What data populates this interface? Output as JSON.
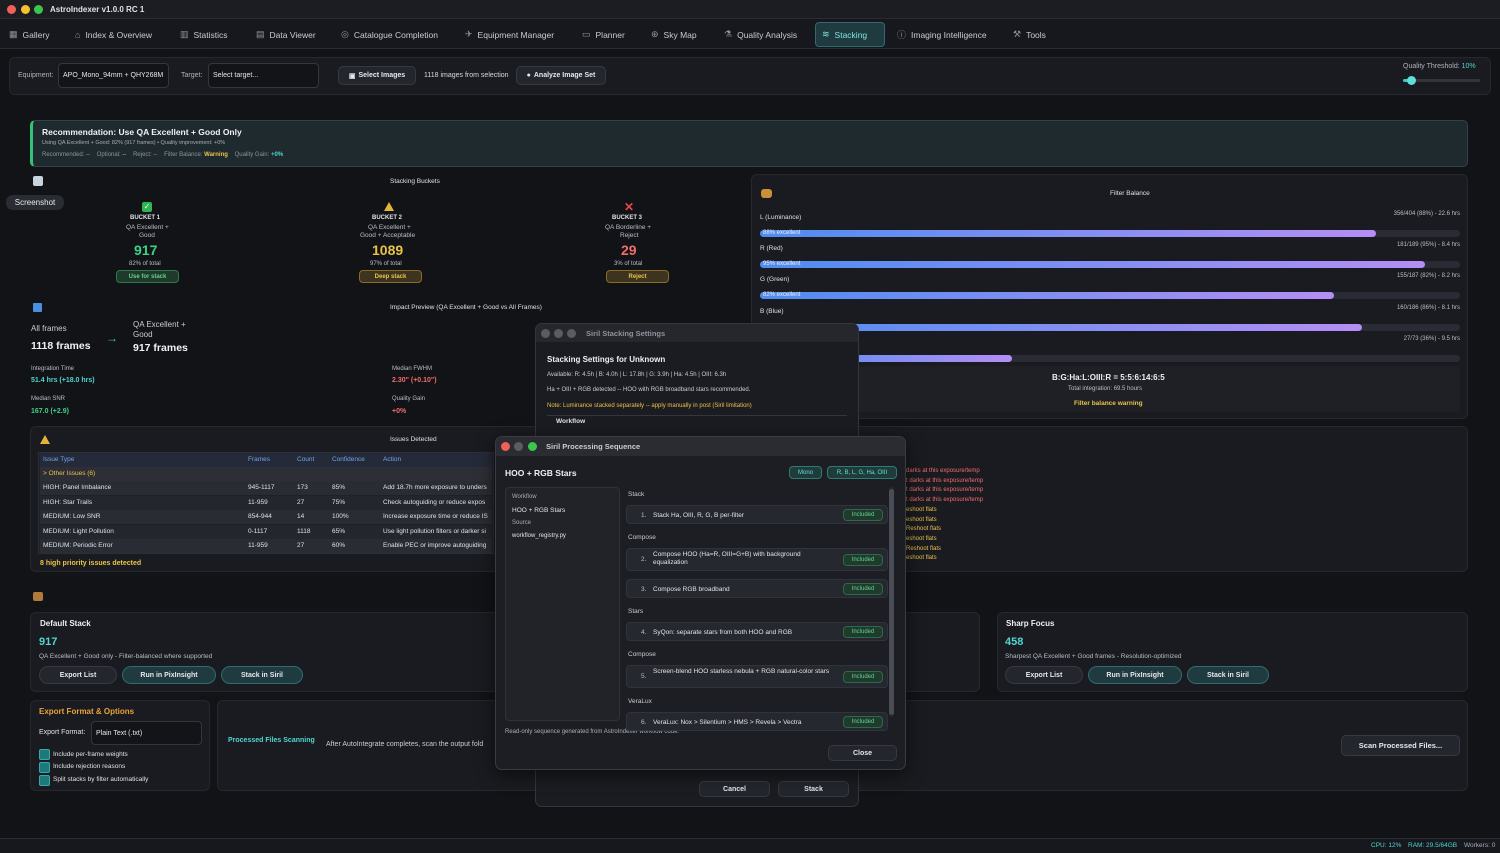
{
  "app": {
    "title": "AstroIndexer v1.0.0 RC 1"
  },
  "tabs": [
    {
      "label": "Gallery",
      "icon": "grid-icon"
    },
    {
      "label": "Index & Overview",
      "icon": "home-icon"
    },
    {
      "label": "Statistics",
      "icon": "bar-chart-icon"
    },
    {
      "label": "Data Viewer",
      "icon": "document-icon"
    },
    {
      "label": "Catalogue Completion",
      "icon": "target-icon"
    },
    {
      "label": "Equipment Manager",
      "icon": "telescope-icon"
    },
    {
      "label": "Planner",
      "icon": "calendar-icon"
    },
    {
      "label": "Sky Map",
      "icon": "globe-icon"
    },
    {
      "label": "Quality Analysis",
      "icon": "flask-icon"
    },
    {
      "label": "Stacking",
      "icon": "layers-icon"
    },
    {
      "label": "Imaging Intelligence",
      "icon": "info-icon"
    },
    {
      "label": "Tools",
      "icon": "wrench-icon"
    }
  ],
  "toolbar": {
    "equipment_label": "Equipment:",
    "equipment_value": "APO_Mono_94mm + QHY268M",
    "target_label": "Target:",
    "target_placeholder": "Select target...",
    "select_images": "Select Images",
    "images_count": "1118 images from selection",
    "analyze": "Analyze Image Set",
    "quality_label": "Quality Threshold:",
    "quality_value": "10%",
    "quality_fraction": 0.1
  },
  "recommendation": {
    "title": "Recommendation: Use QA Excellent + Good Only",
    "subtitle": "Using QA Excellent + Good: 82% (917 frames) • Quality improvement: +0%",
    "recommended_label": "Recommended:",
    "recommended_value": "--",
    "optional_label": "Optional:",
    "optional_value": "--",
    "reject_label": "Reject:",
    "reject_value": "--",
    "filter_balance_label": "Filter Balance:",
    "filter_balance_value": "Warning",
    "quality_gain_label": "Quality Gain:",
    "quality_gain_value": "+0%"
  },
  "screenshot_tooltip": "Screenshot",
  "buckets": {
    "title": "Stacking Buckets",
    "items": [
      {
        "name": "BUCKET 1",
        "desc1": "QA Excellent +",
        "desc2": "Good",
        "count": "917",
        "pct": "82% of total",
        "action": "Use for stack",
        "icon": "check-icon"
      },
      {
        "name": "BUCKET 2",
        "desc1": "QA Excellent +",
        "desc2": "Good + Acceptable",
        "count": "1089",
        "pct": "97% of total",
        "action": "Deep stack",
        "icon": "warning-icon"
      },
      {
        "name": "BUCKET 3",
        "desc1": "QA Borderline +",
        "desc2": "Reject",
        "count": "29",
        "pct": "3% of total",
        "action": "Reject",
        "icon": "x-icon"
      }
    ]
  },
  "filter_balance": {
    "title": "Filter Balance",
    "filters": [
      {
        "name": "L (Luminance)",
        "stats": "356/404 (88%) - 22.6 hrs",
        "bar_label": "88% excellent",
        "fraction": 0.88
      },
      {
        "name": "R (Red)",
        "stats": "181/189 (95%) - 8.4 hrs",
        "bar_label": "95% excellent",
        "fraction": 0.95
      },
      {
        "name": "G (Green)",
        "stats": "155/187 (82%) - 8.2 hrs",
        "bar_label": "82% excellent",
        "fraction": 0.82
      },
      {
        "name": "B (Blue)",
        "stats": "160/186 (86%) - 8.1 hrs",
        "bar_label": "",
        "fraction": 0.86
      },
      {
        "name": "",
        "stats": "27/73 (36%) - 9.5 hrs",
        "bar_label": "",
        "fraction": 0.36
      }
    ],
    "ratio": "B:G:Ha:L:OIII:R = 5:5:6:14:6:5",
    "total": "Total integration: 69.5 hours",
    "warning": "Filter balance warning"
  },
  "impact": {
    "title": "Impact Preview (QA Excellent + Good vs All Frames)",
    "all_label": "All frames",
    "all_value": "1118 frames",
    "sel_label1": "QA Excellent +",
    "sel_label2": "Good",
    "sel_value": "917 frames",
    "integration_label": "Integration Time",
    "integration_value": "51.4 hrs (+18.0 hrs)",
    "fwhm_label": "Median FWHM",
    "fwhm_value": "2.30\" (+0.10\")",
    "snr_label": "Median SNR",
    "snr_value": "167.0 (+2.9)",
    "gain_label": "Quality Gain",
    "gain_value": "+0%"
  },
  "issues": {
    "title": "Issues Detected",
    "headers": [
      "Issue Type",
      "Frames",
      "Count",
      "Confidence",
      "Action"
    ],
    "group": "> Other Issues (6)",
    "rows": [
      [
        "HIGH: Panel Imbalance",
        "945-1117",
        "173",
        "85%",
        "Add 18.7h more exposure to unders"
      ],
      [
        "HIGH: Star Trails",
        "11-959",
        "27",
        "75%",
        "Check autoguiding or reduce expos"
      ],
      [
        "MEDIUM: Low SNR",
        "854-944",
        "14",
        "100%",
        "Increase exposure time or reduce IS"
      ],
      [
        "MEDIUM: Light Pollution",
        "0-1117",
        "1118",
        "65%",
        "Use light pollution filters or darker si"
      ],
      [
        "MEDIUM: Periodic Error",
        "11-959",
        "27",
        "60%",
        "Enable PEC or improve autoguiding"
      ]
    ],
    "summary": "8 high priority issues detected"
  },
  "right_notes": [
    {
      "text": "darks at this exposure/temp",
      "color": "red"
    },
    {
      "text": "t darks at this exposure/temp",
      "color": "red"
    },
    {
      "text": "t darks at this exposure/temp",
      "color": "red"
    },
    {
      "text": "t darks at this exposure/temp",
      "color": "red"
    },
    {
      "text": "eshoot flats",
      "color": "yellow"
    },
    {
      "text": "eshoot flats",
      "color": "yellow"
    },
    {
      "text": "Reshoot flats",
      "color": "yellow"
    },
    {
      "text": "eshoot flats",
      "color": "yellow"
    },
    {
      "text": "Reshoot flats",
      "color": "yellow"
    },
    {
      "text": "eshoot flats",
      "color": "yellow"
    }
  ],
  "default_stack": {
    "title": "Default Stack",
    "count": "917",
    "desc": "QA Excellent + Good only - Filter-balanced where supported",
    "export": "Export List",
    "pixinsight": "Run in PixInsight",
    "siril": "Stack in Siril"
  },
  "sharp_focus": {
    "title": "Sharp Focus",
    "count": "458",
    "desc": "Sharpest QA Excellent + Good frames - Resolution-optimized",
    "export": "Export List",
    "pixinsight": "Run in PixInsight",
    "siril": "Stack in Siril"
  },
  "export_opts": {
    "title": "Export Format & Options",
    "format_label": "Export Format:",
    "format_value": "Plain Text (.txt)",
    "opt1": "Include per-frame weights",
    "opt2": "Include rejection reasons",
    "opt3": "Split stacks by filter automatically"
  },
  "processed": {
    "title": "Processed Files Scanning",
    "desc": "After AutoIntegrate completes, scan the output fold",
    "scan": "Scan Processed Files..."
  },
  "stack_dialog": {
    "title": "Siril Stacking Settings",
    "heading": "Stacking Settings for Unknown",
    "available": "Available: R: 4.5h | B: 4.0h | L: 17.8h | G: 3.9h | Ha: 4.5h | OIII: 6.3h",
    "detected": "Ha + OIII + RGB detected -- HOO with RGB broadband stars recommended.",
    "note": "Note: Luminance stacked separately -- apply manually in post (Siril limitation)",
    "workflow_tab": "Workflow",
    "cancel": "Cancel",
    "stack": "Stack"
  },
  "seq_dialog": {
    "title": "Siril Processing Sequence",
    "heading": "HOO + RGB Stars",
    "mono": "Mono",
    "filters": "R, B, L, G, Ha, OIII",
    "side": [
      "Workflow",
      "HOO + RGB Stars",
      "Source",
      "workflow_registry.py"
    ],
    "sections": [
      {
        "name": "Stack",
        "steps": [
          {
            "num": "1.",
            "text": "Stack Ha, OIII, R, G, B per-filter"
          }
        ]
      },
      {
        "name": "Compose",
        "steps": [
          {
            "num": "2.",
            "text": "Compose HOO (Ha=R, OIII=G+B) with background equalization"
          },
          {
            "num": "3.",
            "text": "Compose RGB broadband"
          }
        ]
      },
      {
        "name": "Stars",
        "steps": [
          {
            "num": "4.",
            "text": "SyQon: separate stars from both HOO and RGB"
          }
        ]
      },
      {
        "name": "Compose",
        "steps": [
          {
            "num": "5.",
            "text": "Screen-blend HOO starless nebula + RGB natural-color stars"
          }
        ]
      },
      {
        "name": "VeraLux",
        "steps": [
          {
            "num": "6.",
            "text": "VeraLux: Nox > Silentium > HMS > Revela > Vectra"
          }
        ]
      }
    ],
    "included": "Included",
    "footer": "Read-only sequence generated from AstroIndexer workflow code.",
    "close": "Close"
  },
  "status": {
    "cpu": "CPU: 12%",
    "ram": "RAM: 29.5/64GB",
    "workers": "Workers: 0"
  }
}
